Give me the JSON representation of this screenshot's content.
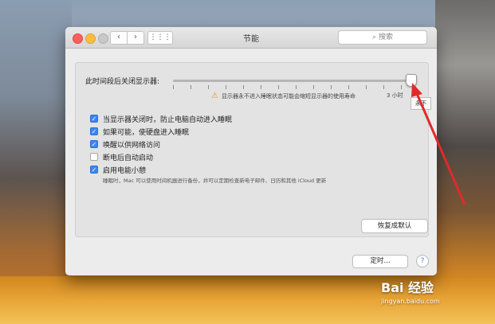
{
  "window": {
    "title": "节能",
    "search_placeholder": "搜索",
    "nav_back": "‹",
    "nav_forward": "›",
    "grid_icon": "⋮⋮⋮"
  },
  "display_sleep": {
    "label": "此时间段后关闭显示器:",
    "warning": "显示器永不进入睡眠状态可能会缩短显示器的使用寿命",
    "time_3h": "3 小时",
    "never_tip": "永不",
    "slider_value": "永不"
  },
  "options": [
    {
      "label": "当显示器关闭时，防止电脑自动进入睡眠",
      "checked": true
    },
    {
      "label": "如果可能，使硬盘进入睡眠",
      "checked": true
    },
    {
      "label": "唤醒以供网络访问",
      "checked": true
    },
    {
      "label": "断电后自动启动",
      "checked": false
    },
    {
      "label": "启用电能小憩",
      "checked": true
    }
  ],
  "power_nap_note": "睡眠时，Mac 可以使用时间机器进行备份，并可以定期检查新电子邮件、日历和其他 iCloud 更新",
  "buttons": {
    "restore_defaults": "恢复成默认",
    "schedule": "定时...",
    "help": "?"
  },
  "watermark": {
    "brand": "Bai 经验",
    "url": "jingyan.baidu.com"
  },
  "colors": {
    "accent": "#3c86f5",
    "annotation_arrow": "#e02a2a"
  }
}
